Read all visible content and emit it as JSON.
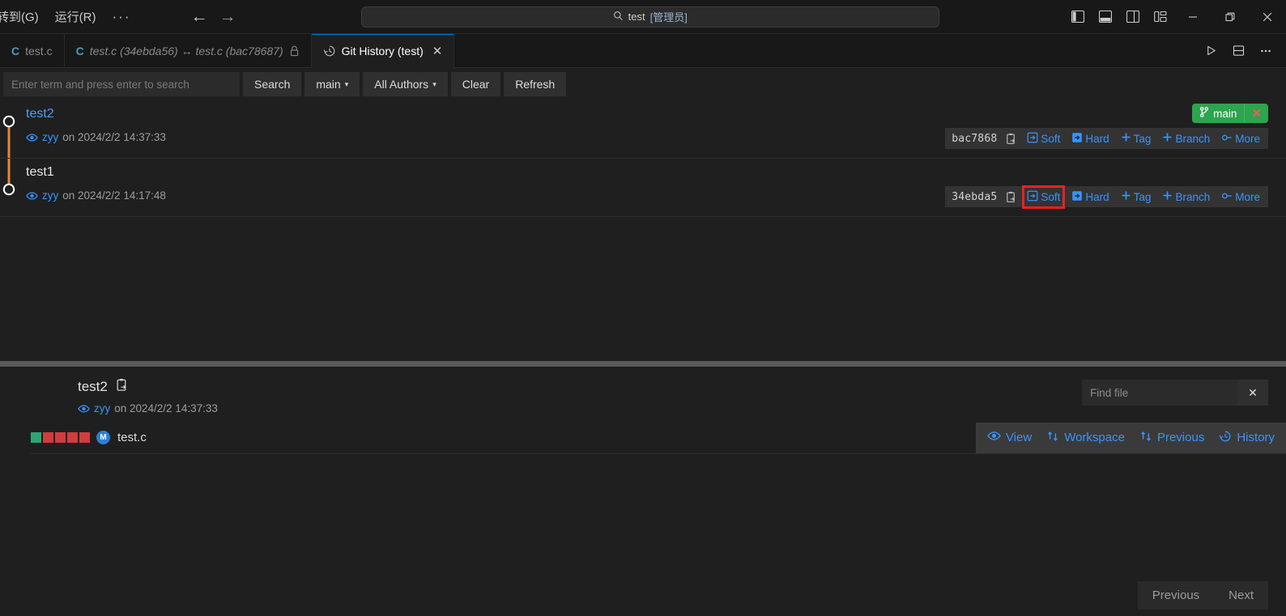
{
  "titlebar": {
    "menus": [
      {
        "label": "转到(G)",
        "name": "menu-goto"
      },
      {
        "label": "运行(R)",
        "name": "menu-run"
      }
    ],
    "overflow_label": "···",
    "back_arrow": "←",
    "forward_arrow": "→",
    "quick_input": "test [管理员]",
    "quick_input_plain": "test ",
    "quick_input_admin": "[管理员]",
    "minimize": "–",
    "restore": "❐",
    "close": "✕"
  },
  "tabs": [
    {
      "label": "test.c",
      "icon": "c-file-icon",
      "name": "tab-test-c",
      "active": false,
      "italic": false,
      "locked": false
    },
    {
      "label": "test.c (34ebda56) ↔ test.c (bac78687)",
      "icon": "c-file-icon",
      "name": "tab-diff",
      "active": false,
      "italic": true,
      "locked": true
    },
    {
      "label": "Git History (test)",
      "icon": "history-icon",
      "name": "tab-git-history",
      "active": true,
      "italic": false,
      "locked": false
    }
  ],
  "tab_close_glyph": "✕",
  "toolbar": {
    "search_placeholder": "Enter term and press enter to search",
    "search_value": "",
    "search_label": "Search",
    "branch_label": "main",
    "authors_label": "All Authors",
    "clear_label": "Clear",
    "refresh_label": "Refresh",
    "caret": "▾"
  },
  "commits": [
    {
      "subject": "test2",
      "author": "zyy",
      "date_text": "on 2024/2/2 14:37:33",
      "hash": "bac7868",
      "is_link": true,
      "branch_badge": {
        "label": "main",
        "close": "✕"
      },
      "actions": [
        {
          "label": "Soft",
          "icon": "reset-soft-icon",
          "highlighted": false
        },
        {
          "label": "Hard",
          "icon": "reset-hard-icon",
          "highlighted": false
        },
        {
          "label": "Tag",
          "icon": "plus-icon",
          "highlighted": false
        },
        {
          "label": "Branch",
          "icon": "plus-icon",
          "highlighted": false
        },
        {
          "label": "More",
          "icon": "more-icon",
          "highlighted": false
        }
      ]
    },
    {
      "subject": "test1",
      "author": "zyy",
      "date_text": "on 2024/2/2 14:17:48",
      "hash": "34ebda5",
      "is_link": false,
      "branch_badge": null,
      "actions": [
        {
          "label": "Soft",
          "icon": "reset-soft-icon",
          "highlighted": true
        },
        {
          "label": "Hard",
          "icon": "reset-hard-icon",
          "highlighted": false
        },
        {
          "label": "Tag",
          "icon": "plus-icon",
          "highlighted": false
        },
        {
          "label": "Branch",
          "icon": "plus-icon",
          "highlighted": false
        },
        {
          "label": "More",
          "icon": "more-icon",
          "highlighted": false
        }
      ]
    }
  ],
  "detail": {
    "title": "test2",
    "author": "zyy",
    "date_text": "on 2024/2/2 14:37:33",
    "find_placeholder": "Find file",
    "find_value": "",
    "find_close": "✕",
    "file": {
      "name": "test.c",
      "status_badge": "M",
      "squares": [
        "#2ea573",
        "#d13c3c",
        "#d13c3c",
        "#d13c3c",
        "#d13c3c"
      ],
      "actions": [
        {
          "label": "View",
          "icon": "eye-icon"
        },
        {
          "label": "Workspace",
          "icon": "compare-icon"
        },
        {
          "label": "Previous",
          "icon": "compare-icon"
        },
        {
          "label": "History",
          "icon": "history-icon"
        }
      ]
    }
  },
  "pagination": {
    "previous_label": "Previous",
    "next_label": "Next"
  },
  "colors": {
    "accent_blue": "#3794ff",
    "branch_green": "#2da44e",
    "graph_orange": "#e8853b",
    "highlight_red": "#ef2020",
    "added_green": "#2ea573",
    "deleted_red": "#d13c3c"
  }
}
